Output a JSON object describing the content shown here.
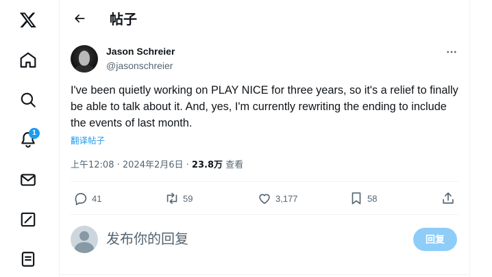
{
  "sidebar": {
    "items": [
      {
        "icon": "x-logo-icon"
      },
      {
        "icon": "home-icon"
      },
      {
        "icon": "search-icon"
      },
      {
        "icon": "notifications-icon",
        "badge": "1"
      },
      {
        "icon": "messages-icon"
      },
      {
        "icon": "grok-icon"
      },
      {
        "icon": "lists-icon"
      }
    ]
  },
  "header": {
    "title": "帖子"
  },
  "tweet": {
    "author_name": "Jason Schreier",
    "author_handle": "@jasonschreier",
    "text": "I've been quietly working on PLAY NICE for three years, so it's a relief to finally be able to talk about it. And, yes, I'm currently rewriting the ending to include the events of last month.",
    "translate_label": "翻译帖子",
    "time": "上午12:08",
    "date": "2024年2月6日",
    "views_count": "23.8万",
    "views_label": "查看"
  },
  "actions": {
    "replies": "41",
    "reposts": "59",
    "likes": "3,177",
    "bookmarks": "58"
  },
  "reply_box": {
    "placeholder": "发布你的回复",
    "button_label": "回复"
  },
  "colors": {
    "accent": "#1d9bf0",
    "reply_button_disabled": "#8ecdf8",
    "secondary_text": "#536471"
  }
}
